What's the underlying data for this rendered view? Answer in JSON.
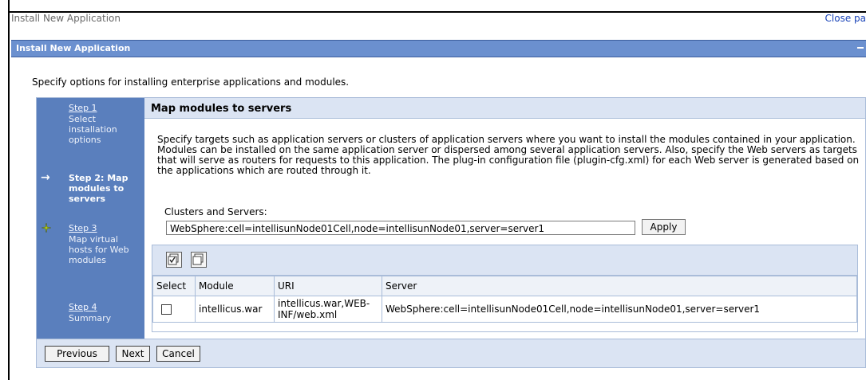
{
  "window": {
    "title": "Install New Application",
    "close_label": "Close pa"
  },
  "panel": {
    "title": "Install New Application"
  },
  "intro": "Specify options for installing enterprise applications and modules.",
  "steps": [
    {
      "number": "Step 1",
      "description": "Select installation options",
      "current": false
    },
    {
      "number": "Step 2: Map modules to servers",
      "description": "",
      "current": true
    },
    {
      "number": "Step 3",
      "description": "Map virtual hosts for Web modules",
      "current": false
    },
    {
      "number": "Step 4",
      "description": "Summary",
      "current": false
    }
  ],
  "content": {
    "title": "Map modules to servers",
    "description": "Specify targets such as application servers or clusters of application servers where you want to install the modules contained in your application. Modules can be installed on the same application server or dispersed among several application servers. Also, specify the Web servers as targets that will serve as routers for requests to this application. The plug-in configuration file (plugin-cfg.xml) for each Web server is generated based on the applications which are routed through it.",
    "field_label": "Clusters and Servers:",
    "selected_server": "WebSphere:cell=intellisunNode01Cell,node=intellisunNode01,server=server1",
    "apply_label": "Apply"
  },
  "table": {
    "toolbar_icons": [
      "select-all-icon",
      "deselect-all-icon"
    ],
    "headers": [
      "Select",
      "Module",
      "URI",
      "Server"
    ],
    "rows": [
      {
        "selected": false,
        "module": "intellicus.war",
        "uri": "intellicus.war,WEB-INF/web.xml",
        "server": "WebSphere:cell=intellisunNode01Cell,node=intellisunNode01,server=server1"
      }
    ]
  },
  "buttons": {
    "previous": "Previous",
    "next": "Next",
    "cancel": "Cancel"
  }
}
